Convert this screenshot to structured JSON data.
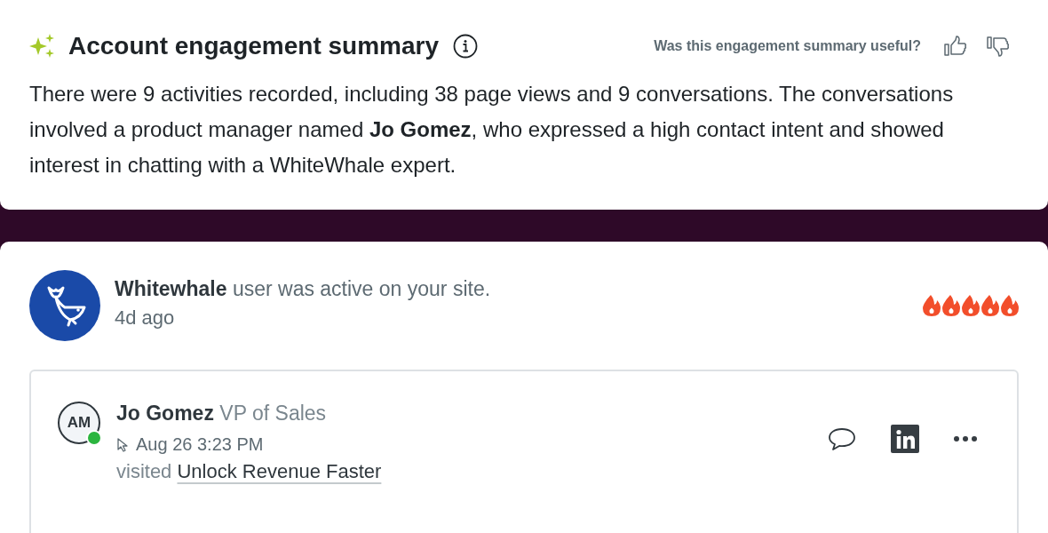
{
  "summary": {
    "title": "Account engagement summary",
    "feedback_prompt": "Was this engagement summary useful?",
    "text": "There were 9 activities recorded, including 38 page views and 9 conversations. The conversations involved a product manager named **Jo Gomez**, who expressed a high contact intent and showed interest in chatting with a WhiteWhale expert."
  },
  "activity": {
    "company": "Whitewhale",
    "message": "user was active on your site.",
    "time": "4d ago",
    "stars": 5,
    "visitor": {
      "initials": "AM",
      "online": true,
      "name": "Jo Gomez",
      "role": "VP of Sales",
      "timestamp": "Aug 26 3:23 PM",
      "action": "visited",
      "page": "Unlock Revenue Faster"
    }
  }
}
